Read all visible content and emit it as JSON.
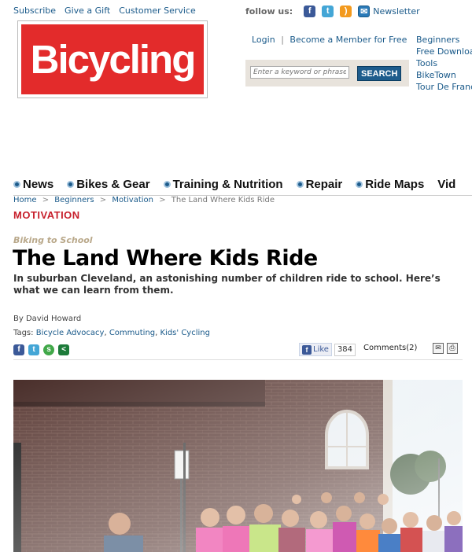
{
  "top_links": [
    "Subscribe",
    "Give a Gift",
    "Customer Service"
  ],
  "logo_text": "Bicycling",
  "follow": {
    "label": "follow us:",
    "newsletter": "Newsletter",
    "icons": [
      "facebook-icon",
      "twitter-icon",
      "rss-icon",
      "newsletter-icon"
    ]
  },
  "account": {
    "login": "Login",
    "separator": "|",
    "member": "Become a Member for Free"
  },
  "search": {
    "placeholder": "Enter a keyword or phrase",
    "button": "SEARCH"
  },
  "right_links": [
    "Beginners",
    "Free Downloads",
    "Tools",
    "BikeTown",
    "Tour De France"
  ],
  "nav": [
    "News",
    "Bikes & Gear",
    "Training & Nutrition",
    "Repair",
    "Ride Maps",
    "Vid"
  ],
  "breadcrumb": {
    "items": [
      "Home",
      "Beginners",
      "Motivation"
    ],
    "current": "The Land Where Kids Ride",
    "sep": ">"
  },
  "section": "MOTIVATION",
  "article": {
    "kicker": "Biking to School",
    "title": "The Land Where Kids Ride",
    "dek": "In suburban Cleveland, an astonishing number of children ride to school. Here’s what we can learn from them.",
    "byline": "By  David Howard",
    "tags_label": "Tags:",
    "tags": [
      "Bicycle Advocacy",
      "Commuting",
      "Kids' Cycling"
    ]
  },
  "social": {
    "like_label": "Like",
    "like_count": "384",
    "comments": "Comments(2)"
  },
  "colors": {
    "brand": "#e32b2b",
    "link": "#1a5a8a",
    "section": "#c7202c",
    "button": "#1e5c8c"
  }
}
